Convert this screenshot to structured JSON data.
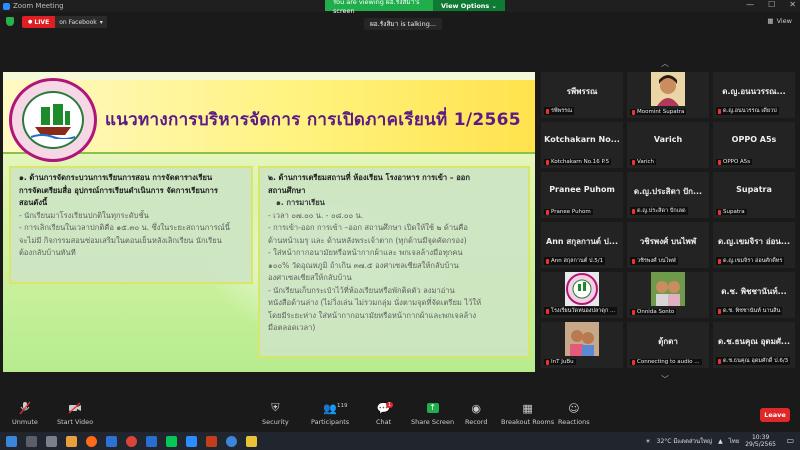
{
  "titlebar": {
    "app_name": "Zoom Meeting",
    "viewing_text": "You are viewing ผอ.รังสิมา's screen",
    "view_options": "View Options ⌄"
  },
  "topbar": {
    "live_label": "LIVE",
    "live_target": "on Facebook",
    "talking": "ผอ.รังสิมา is talking...",
    "view_label": "View"
  },
  "slide": {
    "title": "แนวทางการบริหารจัดการ การเปิดภาคเรียนที่ 1/2565",
    "box1": {
      "heading": [
        "๑.   ด้านการจัดกระบวนการเรียนการสอน การจัดตารางเรียน",
        "การจัดเตรียมสื่อ อุปกรณ์การเรียนดำเนินการ จัดการเรียนการ",
        "สอนดังนี้"
      ],
      "lines": [
        "- นักเรียนมาโรงเรียนปกติในทุกระดับชั้น",
        "- การเลิกเรียนในเวลาปกติคือ ๑๕.๓๐ น.   ซึ่งในระยะสถานการณ์นี้",
        "จะไม่มี กิจกรรมสอนซ่อมเสริมในตอนเย็นหลังเลิกเรียน นักเรียน",
        "ต้องกลับบ้านทันที"
      ]
    },
    "box2": {
      "heading": [
        "๒. ด้านการเตรียมสถานที่ ห้องเรียน   โรงอาหาร การเข้า – ออก",
        "สถานศึกษา"
      ],
      "sub": "๑. การมาเรียน",
      "lines": [
        "- เวลา ๐๗.๐๐ น. - ๐๘.๐๐ น.",
        "- การเข้า-ออก การเข้า –ออก สถานศึกษา เปิดให้ใช้ ๒ ด้านคือ",
        "ด้านหน้าเมรุ และ ด้านหลังพระเจ้าตาก (ทุกด้านมีจุดคัดกรอง)",
        "- ใส่หน้ากากอนามัยหรือหน้ากากผ้าและ   พกเจลล้างมือทุกคน",
        "๑๐๐% วัดอุณหภูมิ ถ้าเกิน ๓๗.๕ องศาเซลเซียสให้กลับบ้าน",
        "องศาเซลเซียสให้กลับบ้าน",
        "- นักเรียนเก็บกระเป๋าไว้ที่ห้องเรียนหรือพักติดตัว ลงมาอ่าน",
        "หนังสือด้านล่าง (ไม่วิ่งเล่น ไม่รวมกลุ่ม นั่งตามจุดที่จัดเตรียม ไว้ให้",
        "โดยมีระยะห่าง ใส่หน้ากากอนามัยหรือหน้ากากผ้าและพกเจลล้าง",
        "มือตลอดเวลา)"
      ]
    }
  },
  "participants": [
    {
      "name": "รพีพรรณ",
      "label": "รพีพรรณ",
      "photo": false
    },
    {
      "name": "",
      "label": "Moomint Supatra",
      "photo": true,
      "photo_kind": "girl"
    },
    {
      "name": "ด.ญ.อนนวรรณ...",
      "label": "ด.ญ.อนนวรรณ  เดียวบ่",
      "photo": false
    },
    {
      "name": "Kotchakarn  No...",
      "label": "Kotchakarn No.16 P.5",
      "photo": false
    },
    {
      "name": "Varich",
      "label": "Varich",
      "photo": false
    },
    {
      "name": "OPPO A5s",
      "label": "OPPO A5s",
      "photo": false
    },
    {
      "name": "Pranee Puhom",
      "label": "Pranee Puhom",
      "photo": false
    },
    {
      "name": "ด.ญ.ประสิดา ปัก...",
      "label": "ด.ญ.ประสิดา ปักเลด",
      "photo": false
    },
    {
      "name": "Supatra",
      "label": "Supatra",
      "photo": false
    },
    {
      "name": "Ann สกุลกานต์ ป...",
      "label": "Ann สกุลกานต์ ป.5/1",
      "photo": false
    },
    {
      "name": "วชิรพงศ์ บนไพฬ่",
      "label": "วชิรพงศ์ บนไพฬ่",
      "photo": false
    },
    {
      "name": "ด.ญ.เขมจิรา อ่อน...",
      "label": "ด.ญ.เขมจิรา อ่อนศักดิ์ทร",
      "photo": false
    },
    {
      "name": "",
      "label": "โรงเรียนวัดหนองปลาดุก ...",
      "photo": true,
      "photo_kind": "logo"
    },
    {
      "name": "",
      "label": "Onnida Sonto",
      "photo": true,
      "photo_kind": "kids"
    },
    {
      "name": "ด.ช. พิชชานันท์...",
      "label": "ด.ช. พิชชานันท์ นานสิน",
      "photo": false
    },
    {
      "name": "",
      "label": "InT JuBu",
      "photo": true,
      "photo_kind": "kids2"
    },
    {
      "name": "ตุ้กตา",
      "label": "Connecting to audio ...",
      "photo": false
    },
    {
      "name": "ด.ช.ธนคุณ อุดมศั...",
      "label": "ด.ช.ธนคุณ อุดมศักดิ์ ป.6/3",
      "photo": false
    }
  ],
  "toolbar": {
    "unmute": "Unmute",
    "start_video": "Start Video",
    "security": "Security",
    "participants": "Participants",
    "participants_count": "119",
    "chat": "Chat",
    "chat_badge": "1",
    "share_screen": "Share Screen",
    "record": "Record",
    "breakout": "Breakout Rooms",
    "reactions": "Reactions",
    "leave": "Leave"
  },
  "taskbar": {
    "weather": "32°C  มีแดดส่วนใหญ่",
    "lang": "ไทย",
    "time": "10:39",
    "date": "29/5/2565"
  },
  "colors": {
    "accent_green": "#1fae4b",
    "live_red": "#e01f24",
    "title_purple": "#5b1a86"
  }
}
